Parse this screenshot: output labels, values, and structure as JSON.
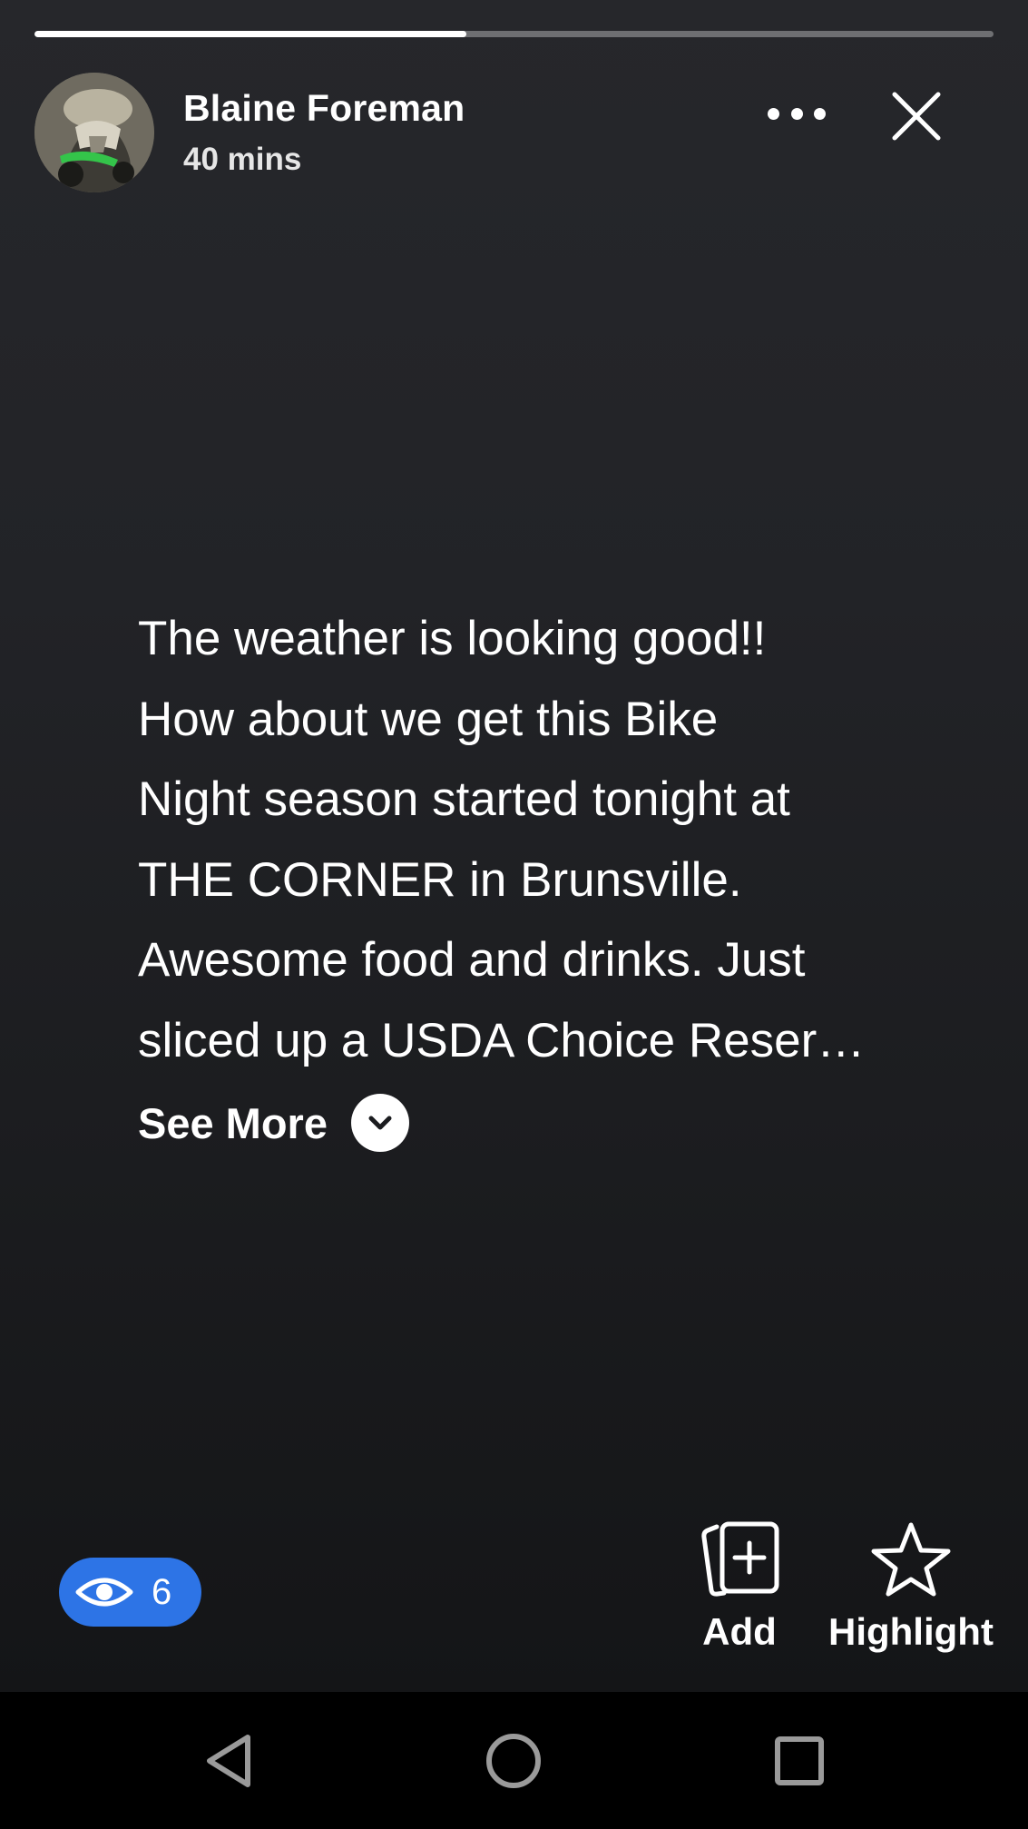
{
  "story": {
    "progress_fraction": 0.45,
    "author_name": "Blaine Foreman",
    "timestamp": "40 mins",
    "text": "The weather is looking good!!\nHow about we get this Bike\nNight season started tonight at\nTHE CORNER in Brunsville.\nAwesome food and drinks.  Just\nsliced up a USDA Choice Reser…",
    "see_more_label": "See More"
  },
  "footer": {
    "viewers_count": "6",
    "add_label": "Add",
    "highlight_label": "Highlight"
  },
  "colors": {
    "accent": "#2d74e6",
    "background": "#222327",
    "nav_bar": "#000000"
  },
  "icons": {
    "more": "more-dots-icon",
    "close": "close-icon",
    "see_more": "chevron-down-icon",
    "viewers": "eye-icon",
    "add": "add-to-story-icon",
    "highlight": "star-icon",
    "nav_back": "back-triangle-icon",
    "nav_home": "home-circle-icon",
    "nav_recents": "recents-square-icon"
  }
}
